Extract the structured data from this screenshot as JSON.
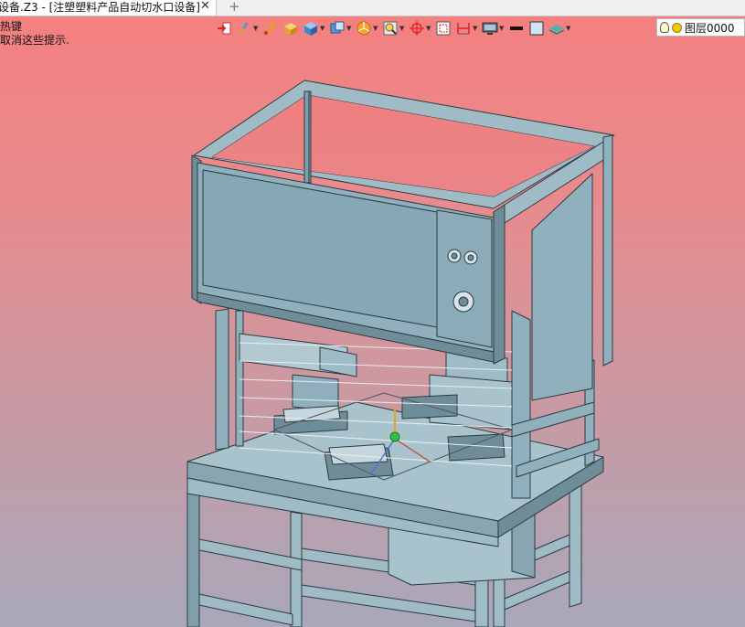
{
  "tab": {
    "title": "设备.Z3 - [注塑塑料产品自动切水口设备]",
    "close": "✕",
    "add": "+"
  },
  "prompt": {
    "line1": "热键",
    "line2": "取消这些提示."
  },
  "toolbar": {
    "buttons": [
      {
        "icon": "import-arrow-icon",
        "dropdown": false
      },
      {
        "icon": "paint-brush-icon",
        "dropdown": true
      },
      {
        "icon": "pencil-icon",
        "dropdown": false
      },
      {
        "icon": "box-color-icon",
        "dropdown": false
      },
      {
        "icon": "blue-cube-icon",
        "dropdown": true
      },
      {
        "icon": "view-cube-icon",
        "dropdown": true
      },
      {
        "icon": "orange-pie-icon",
        "dropdown": true
      },
      {
        "icon": "zoom-fit-icon",
        "dropdown": true
      },
      {
        "icon": "pan-target-icon",
        "dropdown": true
      },
      {
        "icon": "frame-select-icon",
        "dropdown": false
      },
      {
        "icon": "dimension-icon",
        "dropdown": true
      },
      {
        "icon": "monitor-icon",
        "dropdown": true
      },
      {
        "icon": "line-style-icon",
        "dropdown": false
      },
      {
        "icon": "color-swatch-icon",
        "dropdown": false
      },
      {
        "icon": "layer-stack-icon",
        "dropdown": true
      }
    ]
  },
  "layer": {
    "name": "图层0000"
  },
  "colors": {
    "metal": "#9fbcc6",
    "metal_dark": "#6f8d99",
    "panel": "#8fb0bc",
    "edge": "#2c3a40"
  }
}
